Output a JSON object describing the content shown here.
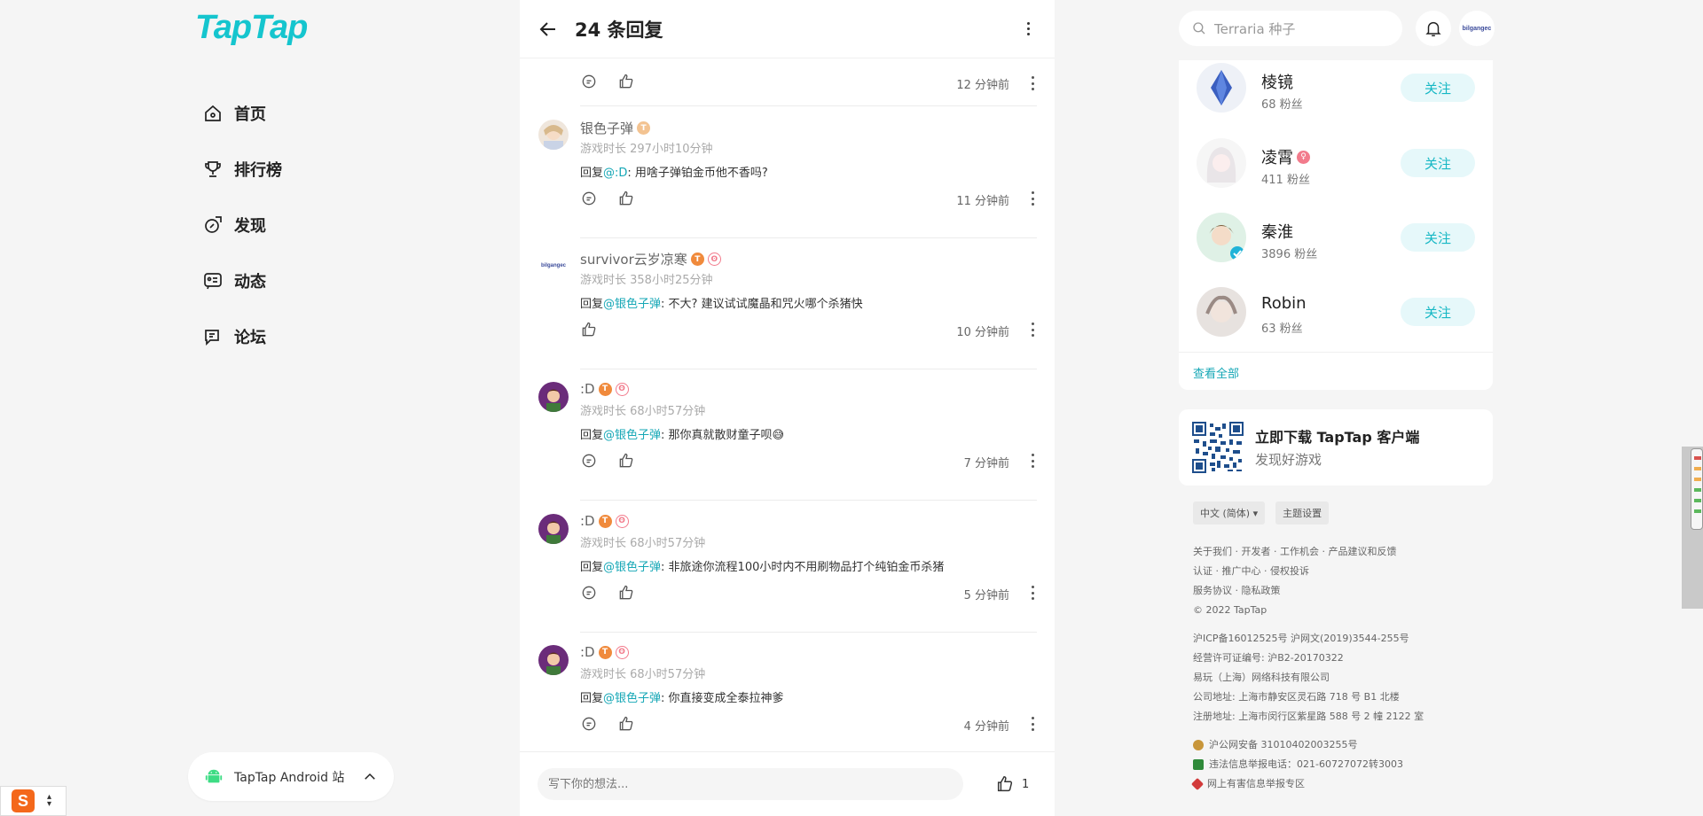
{
  "app": {
    "logo": "TapTap"
  },
  "nav": {
    "items": [
      {
        "label": "首页",
        "icon": "home-icon"
      },
      {
        "label": "排行榜",
        "icon": "trophy-icon"
      },
      {
        "label": "发现",
        "icon": "discover-icon"
      },
      {
        "label": "动态",
        "icon": "feed-icon"
      },
      {
        "label": "论坛",
        "icon": "forum-icon"
      }
    ]
  },
  "android": {
    "label": "TapTap Android 站"
  },
  "header": {
    "title": "24 条回复"
  },
  "top_reply": {
    "time": "12 分钟前"
  },
  "replies": [
    {
      "name": "银色子弹",
      "playtime": "游戏时长 297小时10分钟",
      "prefix": "回复",
      "mention": "@:D",
      "text": ": 用啥子弹铂金币他不香吗?",
      "time": "11 分钟前"
    },
    {
      "name": "survivor云岁凉寒",
      "playtime": "游戏时长 358小时25分钟",
      "prefix": "回复",
      "mention": "@银色子弹",
      "text": ": 不大?  建议试试魔晶和咒火哪个杀猪快",
      "time": "10 分钟前"
    },
    {
      "name": ":D",
      "playtime": "游戏时长 68小时57分钟",
      "prefix": "回复",
      "mention": "@银色子弹",
      "text": ": 那你真就散财童子呗😅",
      "time": "7 分钟前"
    },
    {
      "name": ":D",
      "playtime": "游戏时长 68小时57分钟",
      "prefix": "回复",
      "mention": "@银色子弹",
      "text": ": 非旅途你流程100小时内不用刷物品打个纯铂金币杀猪",
      "time": "5 分钟前"
    },
    {
      "name": ":D",
      "playtime": "游戏时长 68小时57分钟",
      "prefix": "回复",
      "mention": "@银色子弹",
      "text": ": 你直接变成全泰拉神爹",
      "time": "4 分钟前"
    }
  ],
  "comment": {
    "placeholder": "写下你的想法...",
    "likes": "1"
  },
  "search": {
    "placeholder": "Terraria 种子"
  },
  "user": {
    "avatar_text": "bilgangec"
  },
  "follow": {
    "people": [
      {
        "name": "棱镜",
        "fans": "68 粉丝",
        "button": "关注"
      },
      {
        "name": "凌霄",
        "fans": "411 粉丝",
        "button": "关注"
      },
      {
        "name": "秦淮",
        "fans": "3896 粉丝",
        "button": "关注"
      },
      {
        "name": "Robin",
        "fans": "63 粉丝",
        "button": "关注"
      }
    ],
    "see_all": "查看全部"
  },
  "download": {
    "title": "立即下载 TapTap 客户端",
    "subtitle": "发现好游戏"
  },
  "footer": {
    "lang": "中文 (简体) ▾",
    "theme": "主题设置",
    "line1": "关于我们 · 开发者 · 工作机会 · 产品建议和反馈",
    "line2": "认证 · 推广中心 · 侵权投诉",
    "line3": "服务协议 · 隐私政策",
    "line4": "© 2022 TapTap",
    "line5": "沪ICP备16012525号    沪网文(2019)3544-255号",
    "line6": "经营许可证编号: 沪B2-20170322",
    "line7": "易玩（上海）网络科技有限公司",
    "line8": "公司地址: 上海市静安区灵石路 718 号 B1 北楼",
    "line9": "注册地址: 上海市闵行区紫星路 588 号 2 幢 2122 室",
    "line10": "沪公网安备 31010402003255号",
    "line11": "违法信息举报电话：021-60727072转3003",
    "line12": "网上有害信息举报专区"
  },
  "colors": {
    "accent": "#15c5ce",
    "mention": "#15a7b6"
  }
}
